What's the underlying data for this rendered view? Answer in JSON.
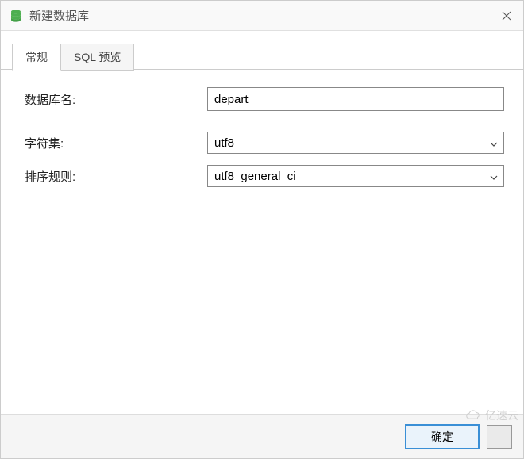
{
  "window": {
    "title": "新建数据库"
  },
  "tabs": {
    "general": "常规",
    "sql_preview": "SQL 预览"
  },
  "fields": {
    "dbname_label": "数据库名:",
    "dbname_value": "depart",
    "charset_label": "字符集:",
    "charset_value": "utf8",
    "collation_label": "排序规则:",
    "collation_value": "utf8_general_ci"
  },
  "footer": {
    "ok": "确定"
  },
  "watermark": {
    "text": "亿速云"
  }
}
